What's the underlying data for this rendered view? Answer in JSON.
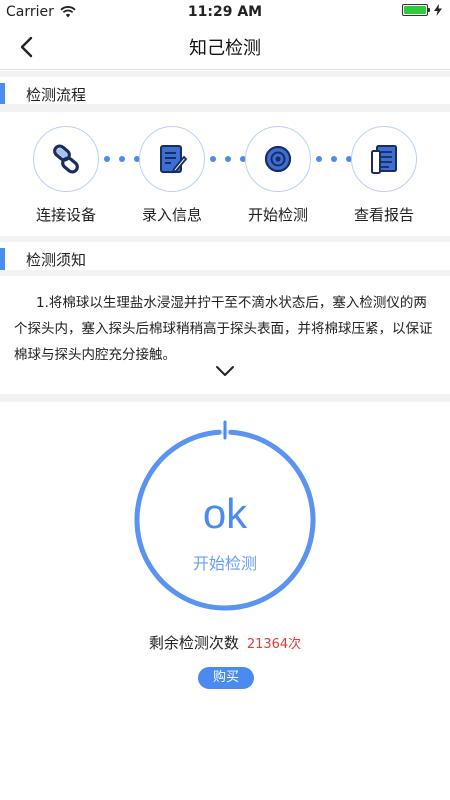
{
  "status_bar": {
    "carrier": "Carrier",
    "time": "11:29 AM"
  },
  "nav": {
    "title": "知己检测"
  },
  "process_section": {
    "title": "检测流程"
  },
  "steps": [
    {
      "label": "连接设备",
      "icon": "link-icon"
    },
    {
      "label": "录入信息",
      "icon": "edit-form-icon"
    },
    {
      "label": "开始检测",
      "icon": "device-start-icon"
    },
    {
      "label": "查看报告",
      "icon": "report-icon"
    }
  ],
  "notice_section": {
    "title": "检测须知"
  },
  "notice": {
    "text": "1.将棉球以生理盐水浸湿并拧干至不滴水状态后，塞入检测仪的两个探头内，塞入探头后棉球稍稍高于探头表面，并将棉球压紧，以保证棉球与探头内腔充分接触。"
  },
  "test": {
    "status": "ok",
    "start_label": "开始检测"
  },
  "remaining": {
    "label": "剩余检测次数",
    "count": "21364次"
  },
  "buy": {
    "label": "购买"
  },
  "colors": {
    "accent": "#4b8bf0",
    "count": "#e73a3a",
    "battery": "#2ecc3a"
  }
}
